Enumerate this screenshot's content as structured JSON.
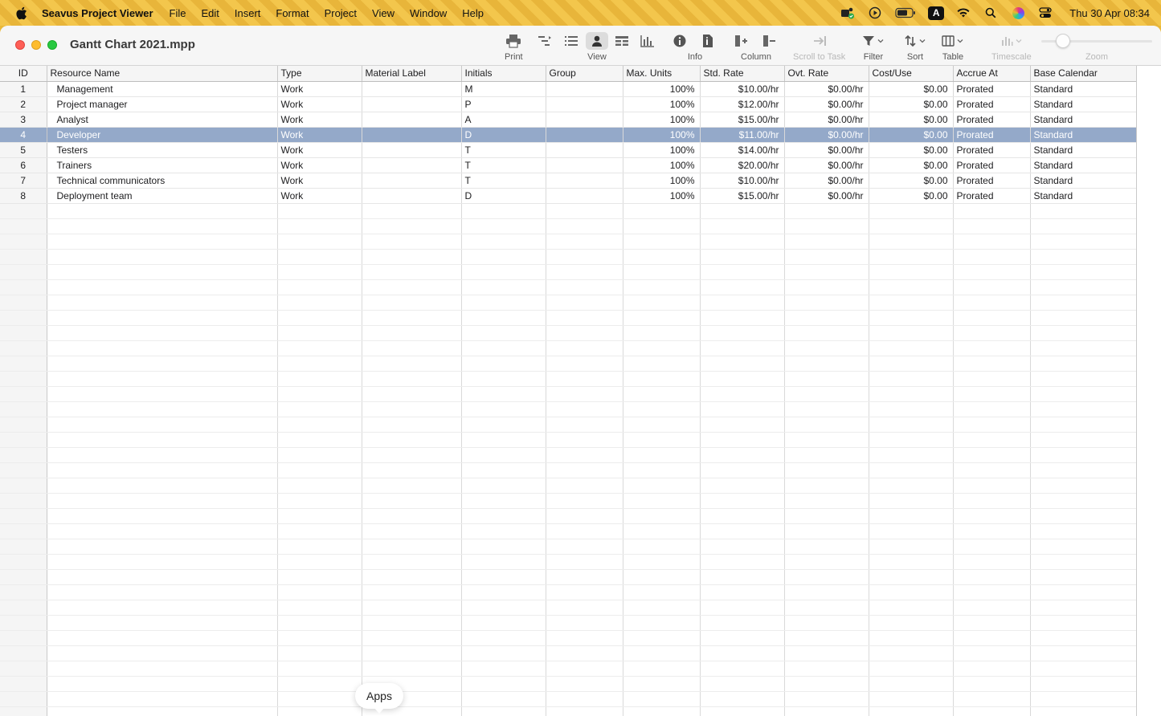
{
  "menubar": {
    "app_name": "Seavus Project Viewer",
    "items": [
      "File",
      "Edit",
      "Insert",
      "Format",
      "Project",
      "View",
      "Window",
      "Help"
    ],
    "clock": "Thu 30 Apr  08:34",
    "status_icons": [
      "teams-icon",
      "play-icon",
      "battery-icon",
      "keyboard-a-icon",
      "wifi-icon",
      "spotlight-icon",
      "siri-icon",
      "control-center-icon"
    ],
    "input_badge": "A"
  },
  "window": {
    "title": "Gantt Chart 2021.mpp"
  },
  "toolbar": {
    "print": "Print",
    "view": "View",
    "info": "Info",
    "column": "Column",
    "scroll_to_task": "Scroll to Task",
    "filter": "Filter",
    "sort": "Sort",
    "table": "Table",
    "timescale": "Timescale",
    "zoom": "Zoom"
  },
  "table": {
    "headers": [
      "ID",
      "Resource Name",
      "Type",
      "Material Label",
      "Initials",
      "Group",
      "Max. Units",
      "Std. Rate",
      "Ovt. Rate",
      "Cost/Use",
      "Accrue At",
      "Base Calendar"
    ],
    "rows": [
      {
        "id": "1",
        "name": "Management",
        "type": "Work",
        "material": "",
        "initials": "M",
        "group": "",
        "max_units": "100%",
        "std_rate": "$10.00/hr",
        "ovt_rate": "$0.00/hr",
        "cost_use": "$0.00",
        "accrue": "Prorated",
        "calendar": "Standard"
      },
      {
        "id": "2",
        "name": "Project manager",
        "type": "Work",
        "material": "",
        "initials": "P",
        "group": "",
        "max_units": "100%",
        "std_rate": "$12.00/hr",
        "ovt_rate": "$0.00/hr",
        "cost_use": "$0.00",
        "accrue": "Prorated",
        "calendar": "Standard"
      },
      {
        "id": "3",
        "name": "Analyst",
        "type": "Work",
        "material": "",
        "initials": "A",
        "group": "",
        "max_units": "100%",
        "std_rate": "$15.00/hr",
        "ovt_rate": "$0.00/hr",
        "cost_use": "$0.00",
        "accrue": "Prorated",
        "calendar": "Standard"
      },
      {
        "id": "4",
        "name": "Developer",
        "type": "Work",
        "material": "",
        "initials": "D",
        "group": "",
        "max_units": "100%",
        "std_rate": "$11.00/hr",
        "ovt_rate": "$0.00/hr",
        "cost_use": "$0.00",
        "accrue": "Prorated",
        "calendar": "Standard"
      },
      {
        "id": "5",
        "name": "Testers",
        "type": "Work",
        "material": "",
        "initials": "T",
        "group": "",
        "max_units": "100%",
        "std_rate": "$14.00/hr",
        "ovt_rate": "$0.00/hr",
        "cost_use": "$0.00",
        "accrue": "Prorated",
        "calendar": "Standard"
      },
      {
        "id": "6",
        "name": "Trainers",
        "type": "Work",
        "material": "",
        "initials": "T",
        "group": "",
        "max_units": "100%",
        "std_rate": "$20.00/hr",
        "ovt_rate": "$0.00/hr",
        "cost_use": "$0.00",
        "accrue": "Prorated",
        "calendar": "Standard"
      },
      {
        "id": "7",
        "name": "Technical communicators",
        "type": "Work",
        "material": "",
        "initials": "T",
        "group": "",
        "max_units": "100%",
        "std_rate": "$10.00/hr",
        "ovt_rate": "$0.00/hr",
        "cost_use": "$0.00",
        "accrue": "Prorated",
        "calendar": "Standard"
      },
      {
        "id": "8",
        "name": "Deployment team",
        "type": "Work",
        "material": "",
        "initials": "D",
        "group": "",
        "max_units": "100%",
        "std_rate": "$15.00/hr",
        "ovt_rate": "$0.00/hr",
        "cost_use": "$0.00",
        "accrue": "Prorated",
        "calendar": "Standard"
      }
    ],
    "selected_row_id": "4"
  },
  "tooltip": {
    "apps": "Apps"
  },
  "colors": {
    "selection": "#94a9c9",
    "close": "#fe5f57",
    "minimize": "#febc2e",
    "maximize": "#28c840"
  }
}
